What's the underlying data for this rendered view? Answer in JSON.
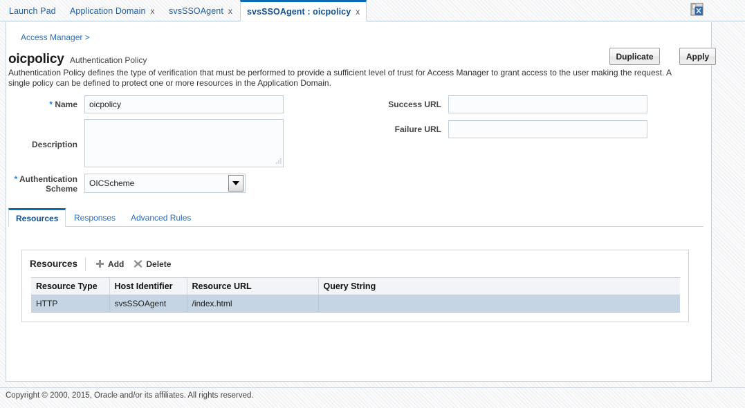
{
  "window": {
    "save_icon": "save-floppy-icon"
  },
  "tabs": [
    {
      "label": "Launch Pad",
      "closable": false,
      "active": false,
      "close": "x"
    },
    {
      "label": "Application Domain",
      "closable": true,
      "active": false,
      "close": "x"
    },
    {
      "label": "svsSSOAgent",
      "closable": true,
      "active": false,
      "close": "x"
    },
    {
      "label": "svsSSOAgent : oicpolicy",
      "closable": true,
      "active": true,
      "close": "x"
    }
  ],
  "breadcrumb": "Access Manager >",
  "page": {
    "title": "oicpolicy",
    "subtitle": "Authentication Policy",
    "description": "Authentication Policy defines the type of verification that must be performed to provide a sufficient level of trust for Access Manager to grant access to the user making the request. A single policy can be defined to protect one or more resources in the Application Domain."
  },
  "actions": {
    "duplicate": "Duplicate",
    "apply": "Apply"
  },
  "form": {
    "required_marker": "*",
    "name_label": "Name",
    "name_value": "oicpolicy",
    "description_label": "Description",
    "description_value": "",
    "auth_scheme_label": "Authentication Scheme",
    "auth_scheme_value": "OICScheme",
    "success_url_label": "Success URL",
    "success_url_value": "",
    "failure_url_label": "Failure URL",
    "failure_url_value": ""
  },
  "subtabs": [
    {
      "label": "Resources",
      "active": true
    },
    {
      "label": "Responses",
      "active": false
    },
    {
      "label": "Advanced Rules",
      "active": false
    }
  ],
  "resources_panel": {
    "title": "Resources",
    "add_label": "Add",
    "delete_label": "Delete",
    "columns": [
      "Resource Type",
      "Host Identifier",
      "Resource URL",
      "Query String"
    ],
    "rows": [
      {
        "resource_type": "HTTP",
        "host_identifier": "svsSSOAgent",
        "resource_url": "/index.html",
        "query_string": ""
      }
    ]
  },
  "footer": {
    "copyright": "Copyright © 2000, 2015, Oracle and/or its affiliates. All rights reserved."
  },
  "colors": {
    "accent_blue": "#0a6bb5",
    "link_blue": "#2a6ebb",
    "row_selected": "#c5d5e4",
    "header_grey": "#f2f4f7"
  }
}
